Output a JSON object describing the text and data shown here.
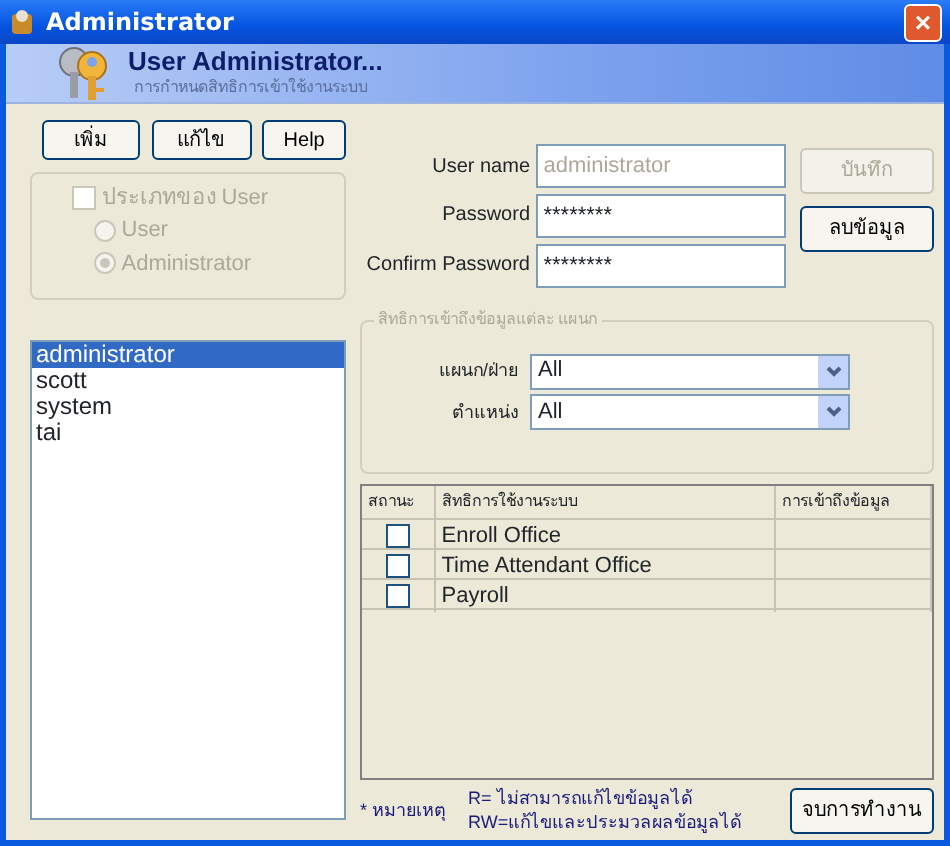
{
  "window": {
    "title": "Administrator",
    "close": "×"
  },
  "header": {
    "title": "User Administrator...",
    "subtitle": "การกำหนดสิทธิการเข้าใช้งานระบบ"
  },
  "toolbar": [
    {
      "label": "เพิ่ม"
    },
    {
      "label": "แก้ไข"
    },
    {
      "label": "Help"
    }
  ],
  "user_type": {
    "label": "ประเภทของ User",
    "checked": false,
    "disabled": true,
    "options": [
      {
        "label": "User",
        "selected": false
      },
      {
        "label": "Administrator",
        "selected": true
      }
    ]
  },
  "fields": [
    {
      "label": "User name",
      "value": "administrator",
      "disabled": true
    },
    {
      "label": "Password",
      "value": "********",
      "disabled": false
    },
    {
      "label": "Confirm Password",
      "value": "********",
      "disabled": false
    }
  ],
  "side_buttons": [
    {
      "label": "บันทึก",
      "disabled": true
    },
    {
      "label": "ลบข้อมูล",
      "disabled": false
    }
  ],
  "users": [
    {
      "name": "administrator",
      "selected": true
    },
    {
      "name": "scott",
      "selected": false
    },
    {
      "name": "system",
      "selected": false
    },
    {
      "name": "tai",
      "selected": false
    }
  ],
  "access": {
    "title": "สิทธิการเข้าถึงข้อมูลแต่ละ แผนก",
    "filters": [
      {
        "label": "แผนก/ฝ่าย",
        "value": "All"
      },
      {
        "label": "ตำแหน่ง",
        "value": "All"
      }
    ]
  },
  "table": {
    "columns": [
      "สถานะ",
      "สิทธิการใช้งานระบบ",
      "การเข้าถึงข้อมูล"
    ],
    "rows": [
      {
        "checked": false,
        "system": "Enroll Office"
      },
      {
        "checked": false,
        "system": "Time Attendant Office"
      },
      {
        "checked": false,
        "system": "Payroll"
      }
    ]
  },
  "note": {
    "label": "* หมายเหตุ",
    "lines": [
      "R= ไม่สามารถแก้ไขข้อมูลได้",
      "RW=แก้ไขและประมวลผลข้อมูลได้"
    ]
  },
  "close_button": "จบการทำงาน"
}
